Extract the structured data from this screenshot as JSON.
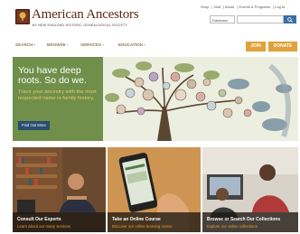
{
  "header": {
    "logo_title": "American Ancestors",
    "logo_subtitle": "BY NEW ENGLAND HISTORIC GENEALOGICAL SOCIETY",
    "top_links": [
      "Shop",
      "Visit",
      "About",
      "Events & Programs",
      "Log In"
    ],
    "search": {
      "scope_value": "Database",
      "placeholder": ""
    }
  },
  "nav": {
    "items": [
      "SEARCH",
      "BROWSE",
      "SERVICES",
      "EDUCATION"
    ],
    "join_label": "JOIN",
    "donate_label": "DONATE"
  },
  "hero": {
    "heading": "You have deep roots. So do we.",
    "text": "Trace your ancestry with the most respected name in family history.",
    "button_label": "Find Out More"
  },
  "tiles": [
    {
      "title": "Consult Our Experts",
      "subtitle": "Learn about our many services"
    },
    {
      "title": "Take an Online Course",
      "subtitle": "Discover our online learning center"
    },
    {
      "title": "Browse or Search Our Collections",
      "subtitle": "Explore our online collections"
    }
  ],
  "colors": {
    "brand_brown": "#5a2a14",
    "accent_orange": "#e0a13a",
    "hero_green": "#6f8f4a",
    "hero_text_gold": "#e7c96a",
    "button_blue": "#2b4d70"
  }
}
